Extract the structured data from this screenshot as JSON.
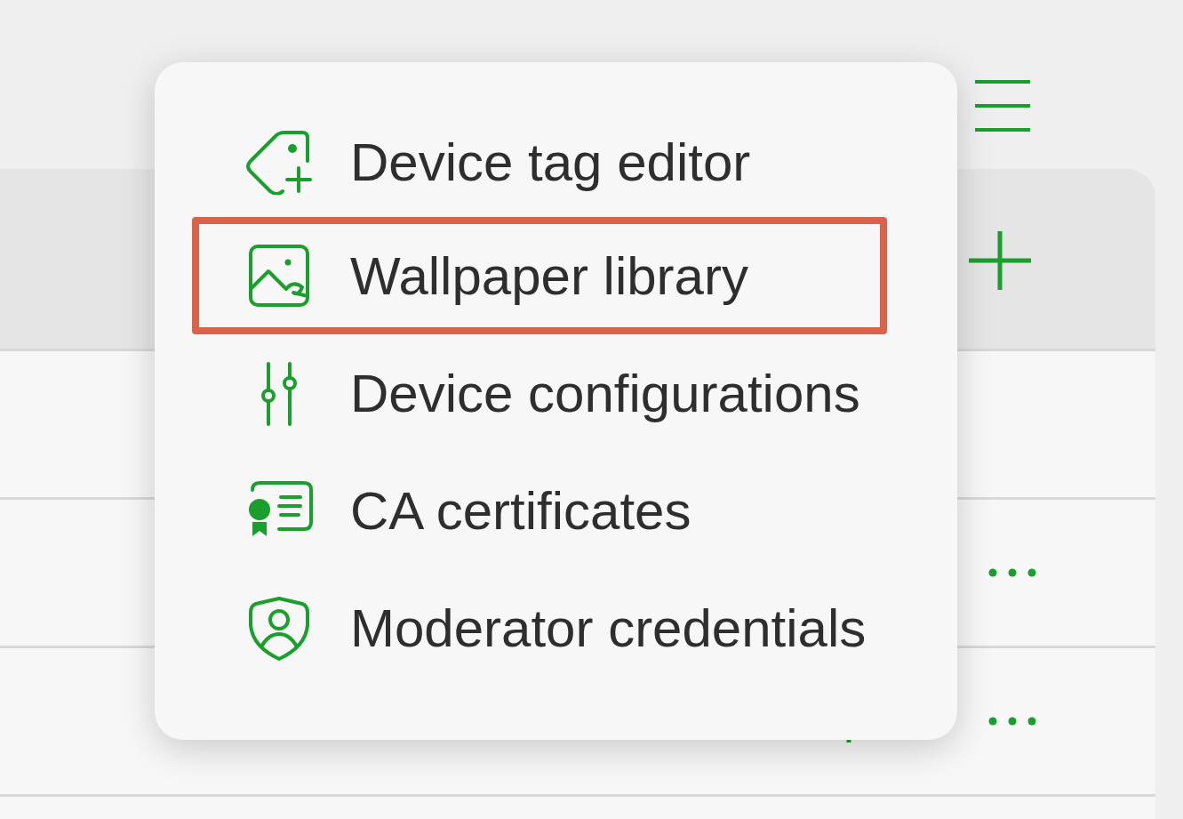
{
  "menu": {
    "items": [
      {
        "label": "Device tag editor",
        "highlighted": false
      },
      {
        "label": "Wallpaper library",
        "highlighted": true
      },
      {
        "label": "Device configurations",
        "highlighted": false
      },
      {
        "label": "CA certificates",
        "highlighted": false
      },
      {
        "label": "Moderator credentials",
        "highlighted": false
      }
    ]
  }
}
